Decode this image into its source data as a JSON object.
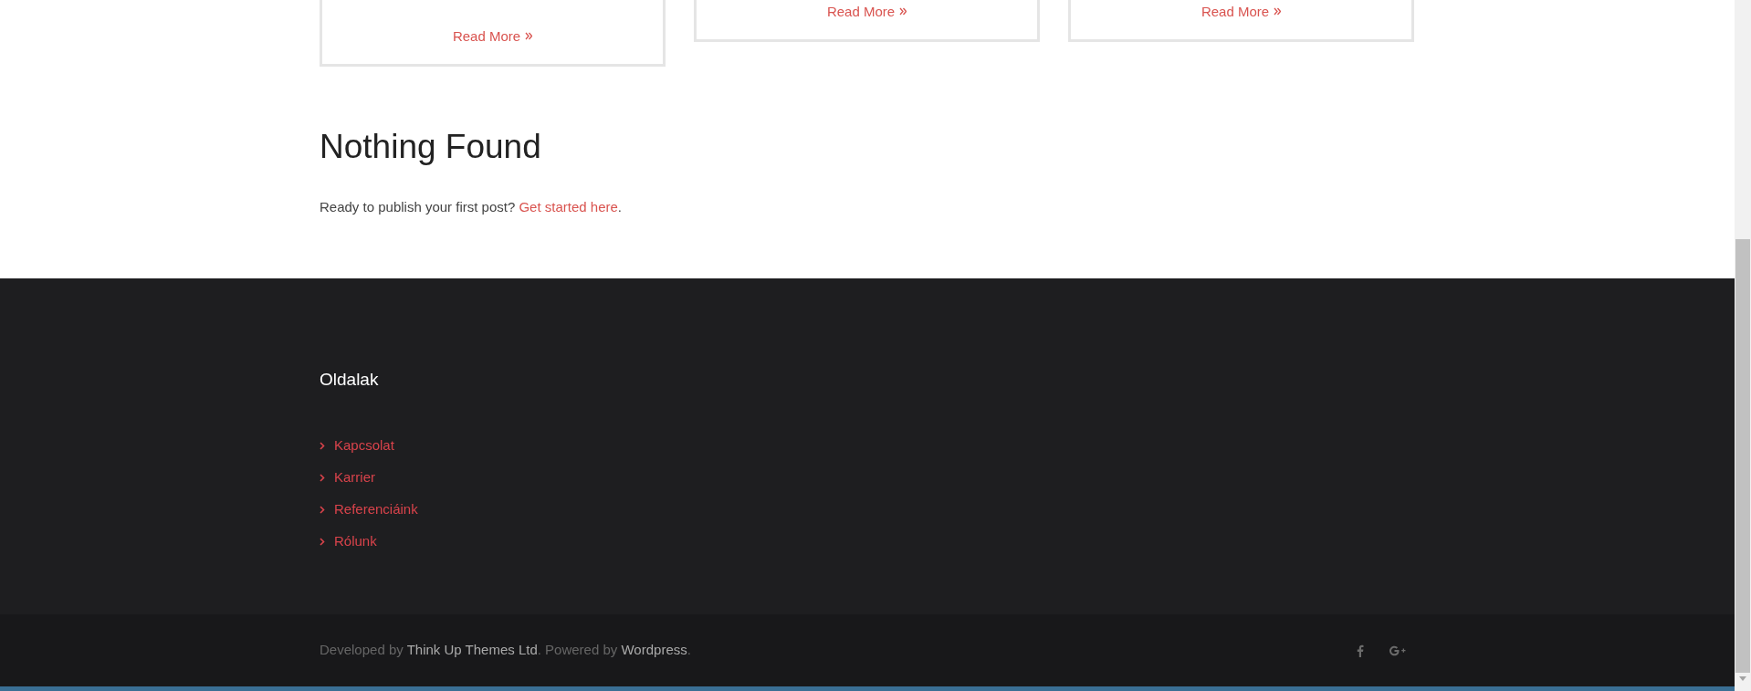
{
  "cards": [
    {
      "link": "Read More"
    },
    {
      "link": "Read More"
    },
    {
      "link": "Read More"
    }
  ],
  "notice": {
    "title": "Nothing Found",
    "text": "Ready to publish your first post?",
    "link": "Get started here",
    "end": "."
  },
  "footer_widget": {
    "title": "Oldalak",
    "items": [
      "Kapcsolat",
      "Karrier",
      "Referenciáink",
      "Rólunk"
    ]
  },
  "copyright": {
    "parts": [
      {
        "kind": "plain",
        "text": "Developed by"
      },
      {
        "kind": "link",
        "text": "Think Up Themes Ltd"
      },
      {
        "kind": "plain",
        "text": ". Powered by"
      },
      {
        "kind": "link",
        "text": "Wordpress"
      },
      {
        "kind": "plain",
        "text": "."
      }
    ]
  },
  "social": [
    {
      "kind": "facebook"
    },
    {
      "kind": "googleplus"
    }
  ]
}
